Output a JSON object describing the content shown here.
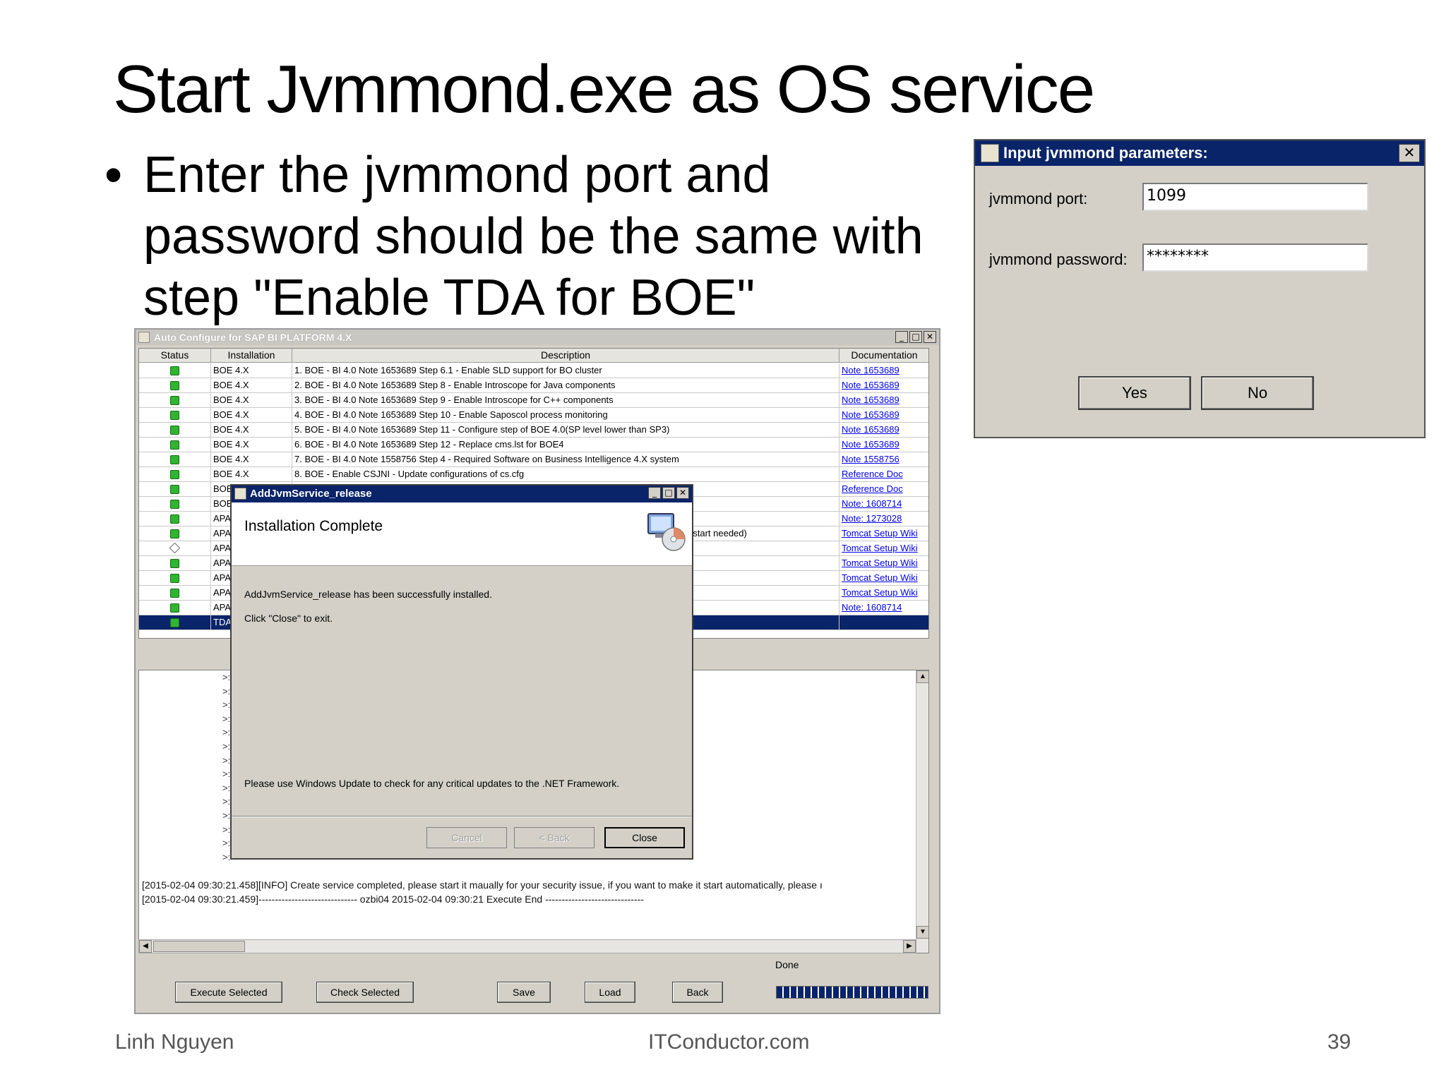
{
  "slide": {
    "title": "Start Jvmmond.exe as OS service",
    "bullet": "Enter the jvmmond port and password should be the same with step \"Enable TDA for BOE\"",
    "footer_left": "Linh Nguyen",
    "footer_center": "ITConductor.com",
    "page_number": "39"
  },
  "app": {
    "title": "Auto Configure for SAP BI PLATFORM  4.X",
    "columns": [
      "Status",
      "Installation",
      "Description",
      "Documentation"
    ],
    "rows": [
      {
        "status": "green",
        "installation": "BOE 4.X",
        "description": "1.  BOE - BI 4.0 Note 1653689 Step 6.1 - Enable SLD support for BO cluster",
        "doc": "Note 1653689"
      },
      {
        "status": "green",
        "installation": "BOE 4.X",
        "description": "2.  BOE - BI 4.0 Note 1653689 Step 8 - Enable Introscope for Java components",
        "doc": "Note 1653689"
      },
      {
        "status": "green",
        "installation": "BOE 4.X",
        "description": "3.  BOE - BI 4.0 Note 1653689 Step 9 - Enable Introscope for C++ components",
        "doc": "Note 1653689"
      },
      {
        "status": "green",
        "installation": "BOE 4.X",
        "description": "4.  BOE - BI 4.0 Note 1653689 Step 10 - Enable Saposcol process monitoring",
        "doc": "Note 1653689"
      },
      {
        "status": "green",
        "installation": "BOE 4.X",
        "description": "5.  BOE - BI 4.0 Note 1653689 Step 11 - Configure step of BOE 4.0(SP level lower than SP3)",
        "doc": "Note 1653689"
      },
      {
        "status": "green",
        "installation": "BOE 4.X",
        "description": "6.  BOE - BI 4.0 Note 1653689 Step 12 - Replace cms.lst for BOE4",
        "doc": "Note 1653689"
      },
      {
        "status": "green",
        "installation": "BOE 4.X",
        "description": "7.  BOE - BI 4.0 Note 1558756 Step 4 - Required Software on Business Intelligence 4.X system",
        "doc": "Note 1558756"
      },
      {
        "status": "green",
        "installation": "BOE 4.X",
        "description": "8.  BOE - Enable CSJNI - Update configurations of cs.cfg",
        "doc": "Reference Doc"
      },
      {
        "status": "green",
        "installation": "BOE",
        "description": "",
        "doc": "Reference Doc"
      },
      {
        "status": "green",
        "installation": "BOE",
        "description": "",
        "doc": "Note: 1608714"
      },
      {
        "status": "green",
        "installation": "APA",
        "description": "",
        "doc": "Note: 1273028"
      },
      {
        "status": "green",
        "installation": "APA",
        "description": "estart needed)",
        "doc": "Tomcat Setup Wiki"
      },
      {
        "status": "pending",
        "installation": "APA",
        "description": "",
        "doc": "Tomcat Setup Wiki"
      },
      {
        "status": "green",
        "installation": "APA",
        "description": "",
        "doc": "Tomcat Setup Wiki"
      },
      {
        "status": "green",
        "installation": "APA",
        "description": "",
        "doc": "Tomcat Setup Wiki"
      },
      {
        "status": "green",
        "installation": "APA",
        "description": "",
        "doc": "Tomcat Setup Wiki"
      },
      {
        "status": "green",
        "installation": "APA",
        "description": "",
        "doc": "Note: 1608714"
      },
      {
        "status": "green",
        "installation": "TDA",
        "description": "",
        "doc": "",
        "selected": true
      }
    ],
    "log_prompt": ">:",
    "log_lines": [
      "[2015-02-04 09:30:21.458][INFO] Create service completed, please start it maually for your security issue, if you want to make it start automatically, please ı",
      "[2015-02-04 09:30:21.459]------------------------------ ozbi04 2015-02-04 09:30:21 Execute End ------------------------------"
    ],
    "progress_label": "Done",
    "progress_value": 1.0,
    "buttons": {
      "execute": "Execute Selected",
      "check": "Check Selected",
      "save": "Save",
      "load": "Load",
      "back": "Back"
    }
  },
  "install_dialog": {
    "title": "AddJvmService_release",
    "heading": "Installation Complete",
    "message1": "AddJvmService_release has been successfully installed.",
    "message2": "Click \"Close\" to exit.",
    "message3": "Please use Windows Update to check for any critical updates to the .NET Framework.",
    "buttons": {
      "cancel": "Cancel",
      "back": "< Back",
      "close": "Close"
    }
  },
  "param_dialog": {
    "title": "Input jvmmond parameters:",
    "close_glyph": "✕",
    "port_label": "jvmmond port:",
    "port_value": "1099",
    "password_label": "jvmmond password:",
    "password_value": "********",
    "yes": "Yes",
    "no": "No"
  }
}
